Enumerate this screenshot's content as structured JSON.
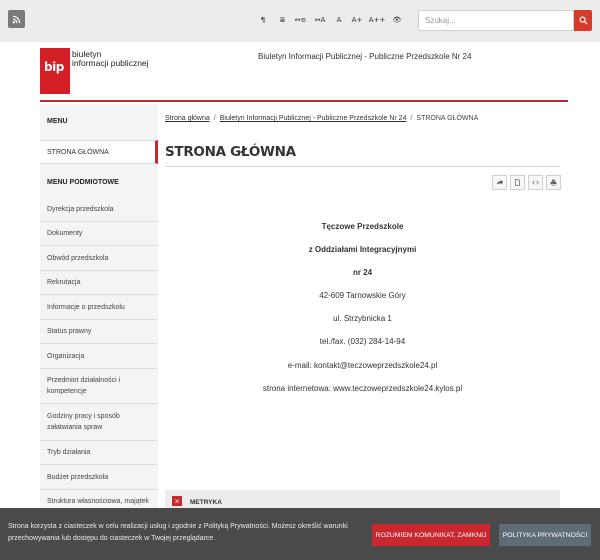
{
  "toolbar": {
    "tools": [
      {
        "label": "¶",
        "name": "paragraph-icon"
      },
      {
        "label": "≣",
        "name": "line-height-icon"
      },
      {
        "label": "↔≡",
        "name": "letter-spacing-icon"
      },
      {
        "label": "↔A",
        "name": "word-spacing-icon"
      },
      {
        "label": "A",
        "name": "font-size-default"
      },
      {
        "label": "A+",
        "name": "font-size-larger"
      },
      {
        "label": "A++",
        "name": "font-size-largest"
      },
      {
        "label": "👁",
        "name": "contrast-eye-icon"
      }
    ],
    "search_placeholder": "Szukaj..."
  },
  "logo": {
    "mark": "bip",
    "line1": "biuletyn",
    "line2": "informacji publicznej"
  },
  "header_title": "Biuletyn Informacji Publicznej - Publiczne Przedszkole Nr 24",
  "sidebar": {
    "menu_heading": "MENU",
    "main_item": "STRONA GŁÓWNA",
    "subject_heading": "MENU PODMIOTOWE",
    "items": [
      "Dyrekcja przedszkola",
      "Dokumenty",
      "Obwód przedszkola",
      "Rekrutacja",
      "Informacje o przedszkolu",
      "Status prawny",
      "Organizacja",
      "Przedmiot działalności i kompetencje",
      "Godziny pracy i sposób załatwiania spraw",
      "Tryb działania",
      "Budżet przedszkola",
      "Struktura własnościowa, majątek"
    ]
  },
  "breadcrumb": {
    "home": "Strona główna",
    "bip": "Biuletyn Informacji Publicznej - Publiczne Przedszkole Nr 24",
    "current": "STRONA GŁÓWNA",
    "separator": "/"
  },
  "page_title": "STRONA GŁÓWNA",
  "content": {
    "line1": "Tęczowe Przedszkole",
    "line2": "z Oddziałami Integracyjnymi",
    "line3": "nr 24",
    "line4": "42-609 Tarnowskie Góry",
    "line5": "ul. Strzybnicka 1",
    "line6": "tel./fax. (032) 284-14-94",
    "line7": "e-mail: kontakt@teczoweprzedszkole24.pl",
    "line8": "strona  internetowa: www.teczoweprzedszkole24.kylos.pl"
  },
  "metryka": {
    "toggle": "×",
    "label": "METRYKA"
  },
  "cookie": {
    "text": "Strona korzysta z ciasteczek w celu realizacji usług i zgodnie z Polityką Prywatności. Możesz określić warunki przechowywania lub dostępu do ciasteczek w Twojej przeglądarce.",
    "accept": "ROZUMIEM KOMUNIKAT, ZAMKNIJ",
    "policy": "POLITYKA PRYWATNOŚCI"
  },
  "colors": {
    "accent_red": "#c9282f",
    "logo_red": "#d51f26",
    "topbar_bg": "#ececec",
    "cookie_bg": "#4a4a4a"
  }
}
